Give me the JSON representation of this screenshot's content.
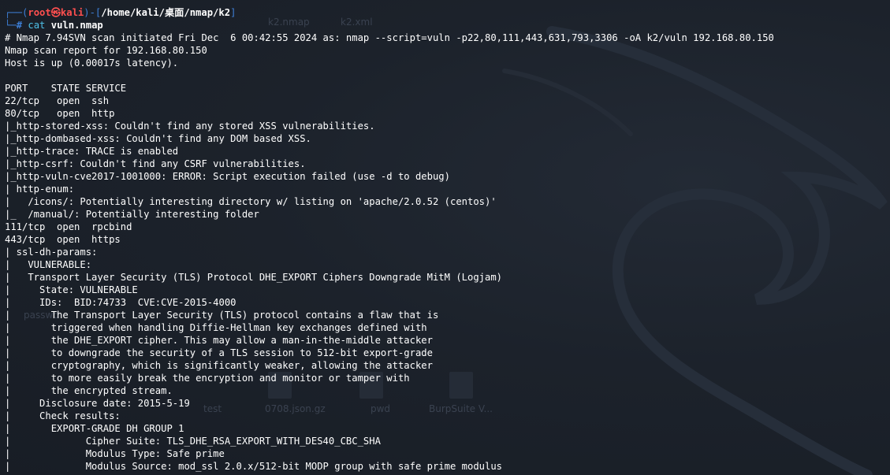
{
  "prompt": {
    "frame_open": "┌──(",
    "user_host": "root㉿kali",
    "frame_mid": ")-[",
    "cwd": "/home/kali/桌面/nmap/k2",
    "frame_close": "]",
    "frame_cmd": "└─",
    "hash": "# ",
    "command": "cat",
    "argument": "vuln.nmap"
  },
  "output_lines": [
    "# Nmap 7.94SVN scan initiated Fri Dec  6 00:42:55 2024 as: nmap --script=vuln -p22,80,111,443,631,793,3306 -oA k2/vuln 192.168.80.150",
    "Nmap scan report for 192.168.80.150",
    "Host is up (0.00017s latency).",
    "",
    "PORT    STATE SERVICE",
    "22/tcp   open  ssh",
    "80/tcp   open  http",
    "|_http-stored-xss: Couldn't find any stored XSS vulnerabilities.",
    "|_http-dombased-xss: Couldn't find any DOM based XSS.",
    "|_http-trace: TRACE is enabled",
    "|_http-csrf: Couldn't find any CSRF vulnerabilities.",
    "|_http-vuln-cve2017-1001000: ERROR: Script execution failed (use -d to debug)",
    "| http-enum:",
    "|   /icons/: Potentially interesting directory w/ listing on 'apache/2.0.52 (centos)'",
    "|_  /manual/: Potentially interesting folder",
    "111/tcp  open  rpcbind",
    "443/tcp  open  https",
    "| ssl-dh-params:",
    "|   VULNERABLE:",
    "|   Transport Layer Security (TLS) Protocol DHE_EXPORT Ciphers Downgrade MitM (Logjam)",
    "|     State: VULNERABLE",
    "|     IDs:  BID:74733  CVE:CVE-2015-4000",
    "|       The Transport Layer Security (TLS) protocol contains a flaw that is",
    "|       triggered when handling Diffie-Hellman key exchanges defined with",
    "|       the DHE_EXPORT cipher. This may allow a man-in-the-middle attacker",
    "|       to downgrade the security of a TLS session to 512-bit export-grade",
    "|       cryptography, which is significantly weaker, allowing the attacker",
    "|       to more easily break the encryption and monitor or tamper with",
    "|       the encrypted stream.",
    "|     Disclosure date: 2015-5-19",
    "|     Check results:",
    "|       EXPORT-GRADE DH GROUP 1",
    "|             Cipher Suite: TLS_DHE_RSA_EXPORT_WITH_DES40_CBC_SHA",
    "|             Modulus Type: Safe prime",
    "|             Modulus Source: mod_ssl 2.0.x/512-bit MODP group with safe prime modulus"
  ],
  "desktop_labels": {
    "a": "k2.nmap",
    "b": "k2.xml",
    "c": "passwd",
    "d": "test",
    "e": "0708.json.gz",
    "f": "pwd",
    "g": "BurpSuite V..."
  },
  "colors": {
    "background": "#1c222b",
    "prompt_frame": "#3e7fd6",
    "prompt_user": "#ff4f4f",
    "command": "#4fc1e9",
    "text": "#ffffff"
  }
}
